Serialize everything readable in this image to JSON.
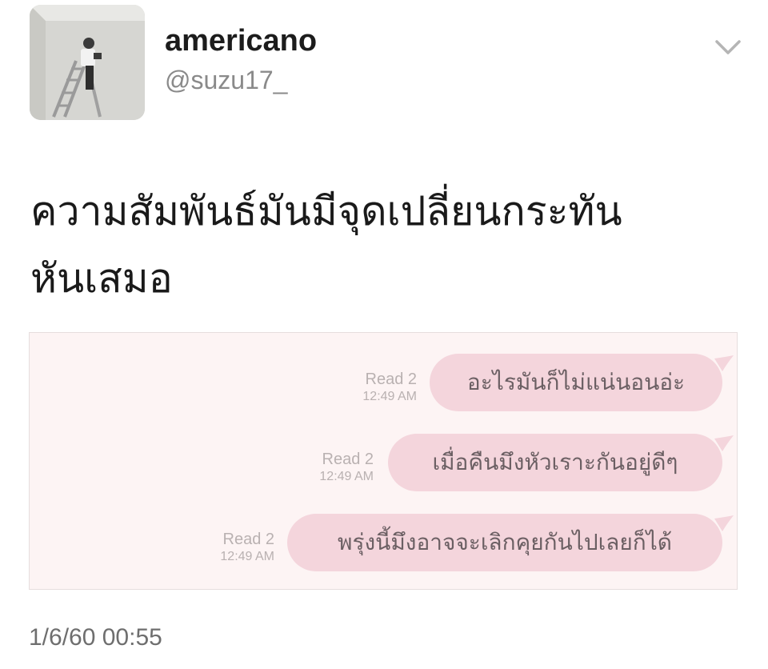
{
  "user": {
    "display_name": "americano",
    "handle": "@suzu17_"
  },
  "tweet": {
    "text_line1": "ความสัมพันธ์มันมีจุดเปลี่ยนกระทัน",
    "text_line2": "หันเสมอ",
    "timestamp": "1/6/60 00:55"
  },
  "chat": {
    "messages": [
      {
        "read": "Read 2",
        "time": "12:49 AM",
        "text": "อะไรมันก็ไม่แน่นอนอ่ะ"
      },
      {
        "read": "Read 2",
        "time": "12:49 AM",
        "text": "เมื่อคืนมึงหัวเราะกันอยู่ดีๆ"
      },
      {
        "read": "Read 2",
        "time": "12:49 AM",
        "text": "พรุ่งนี้มึงอาจจะเลิกคุยกันไปเลยก็ได้"
      }
    ]
  },
  "icons": {
    "menu": "chevron-down-icon",
    "avatar": "profile-photo"
  },
  "colors": {
    "bubble": "#f4d5dc",
    "chat_background": "#fdf4f4",
    "meta_text": "#b9b1b1",
    "handle_text": "#8a8a8a"
  }
}
